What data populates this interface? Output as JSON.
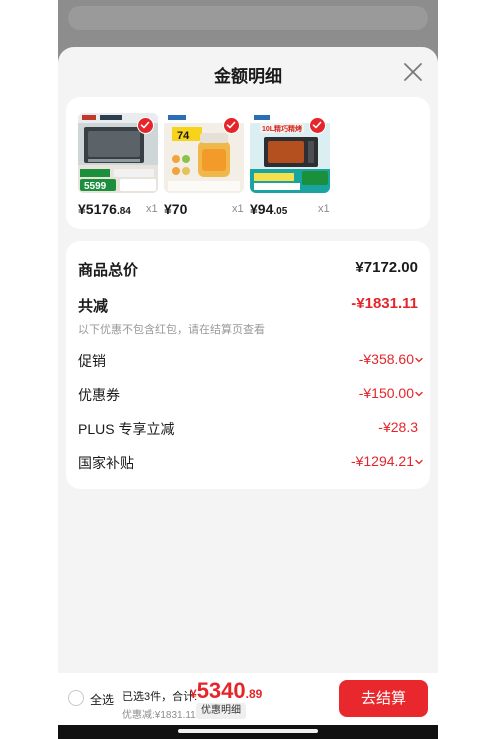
{
  "sheet": {
    "title": "金额明细"
  },
  "products": [
    {
      "price_int": "¥5176",
      "price_dec": ".84",
      "qty": "x1",
      "thumb_text": "5599"
    },
    {
      "price_int": "¥70",
      "price_dec": "",
      "qty": "x1",
      "thumb_text": "74"
    },
    {
      "price_int": "¥94",
      "price_dec": ".05",
      "qty": "x1",
      "thumb_text": "10L精巧精烤"
    }
  ],
  "summary": {
    "total_label": "商品总价",
    "total_value": "¥7172.00",
    "discount_label": "共减",
    "discount_value": "-¥1831.11",
    "note": "以下优惠不包含红包，请在结算页查看",
    "promo_label": "促销",
    "promo_value": "-¥358.60",
    "coupon_label": "优惠券",
    "coupon_value": "-¥150.00",
    "plus_label": "PLUS 专享立减",
    "plus_value": "-¥28.3",
    "subsidy_label": "国家补贴",
    "subsidy_value": "-¥1294.21"
  },
  "bottom": {
    "select_all": "全选",
    "selected_info": "已选3件，合计:",
    "currency": "¥",
    "total_int": "5340",
    "total_dec": ".89",
    "discount_line": "优惠减:¥1831.11",
    "detail_chip": "优惠明细",
    "checkout": "去结算"
  },
  "colors": {
    "accent": "#e5252a",
    "button": "#e8282d",
    "sheet_bg": "#f4f4f4"
  }
}
